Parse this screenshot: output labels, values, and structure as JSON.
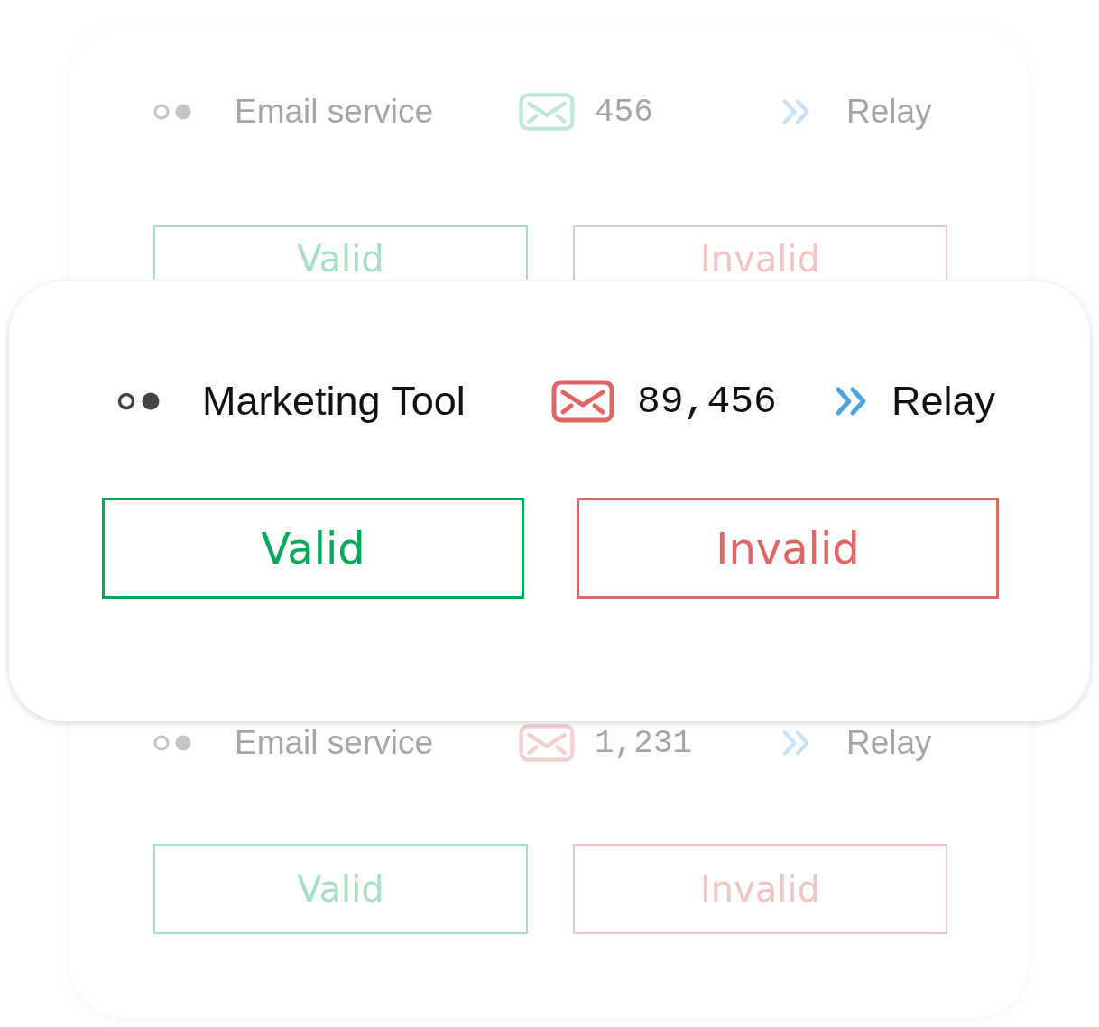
{
  "back_card": {
    "entries": [
      {
        "label": "Email service",
        "count": "456",
        "color": "#bfe9d3",
        "relay": "Relay",
        "buttons": [
          {
            "label": "Valid",
            "kind": "valid"
          },
          {
            "label": "Invalid",
            "kind": "invalid"
          }
        ]
      },
      {
        "label": "Email service",
        "count": "1,231",
        "color": "#f4cfcf",
        "relay": "Relay",
        "buttons": [
          {
            "label": "Valid",
            "kind": "valid"
          },
          {
            "label": "Invalid",
            "kind": "invalid"
          }
        ]
      }
    ]
  },
  "front_card": {
    "label": "Marketing Tool",
    "count": "89,456",
    "color": "#e06666",
    "relay": "Relay",
    "buttons": [
      {
        "label": "Valid",
        "kind": "valid"
      },
      {
        "label": "Invalid",
        "kind": "invalid"
      }
    ]
  }
}
